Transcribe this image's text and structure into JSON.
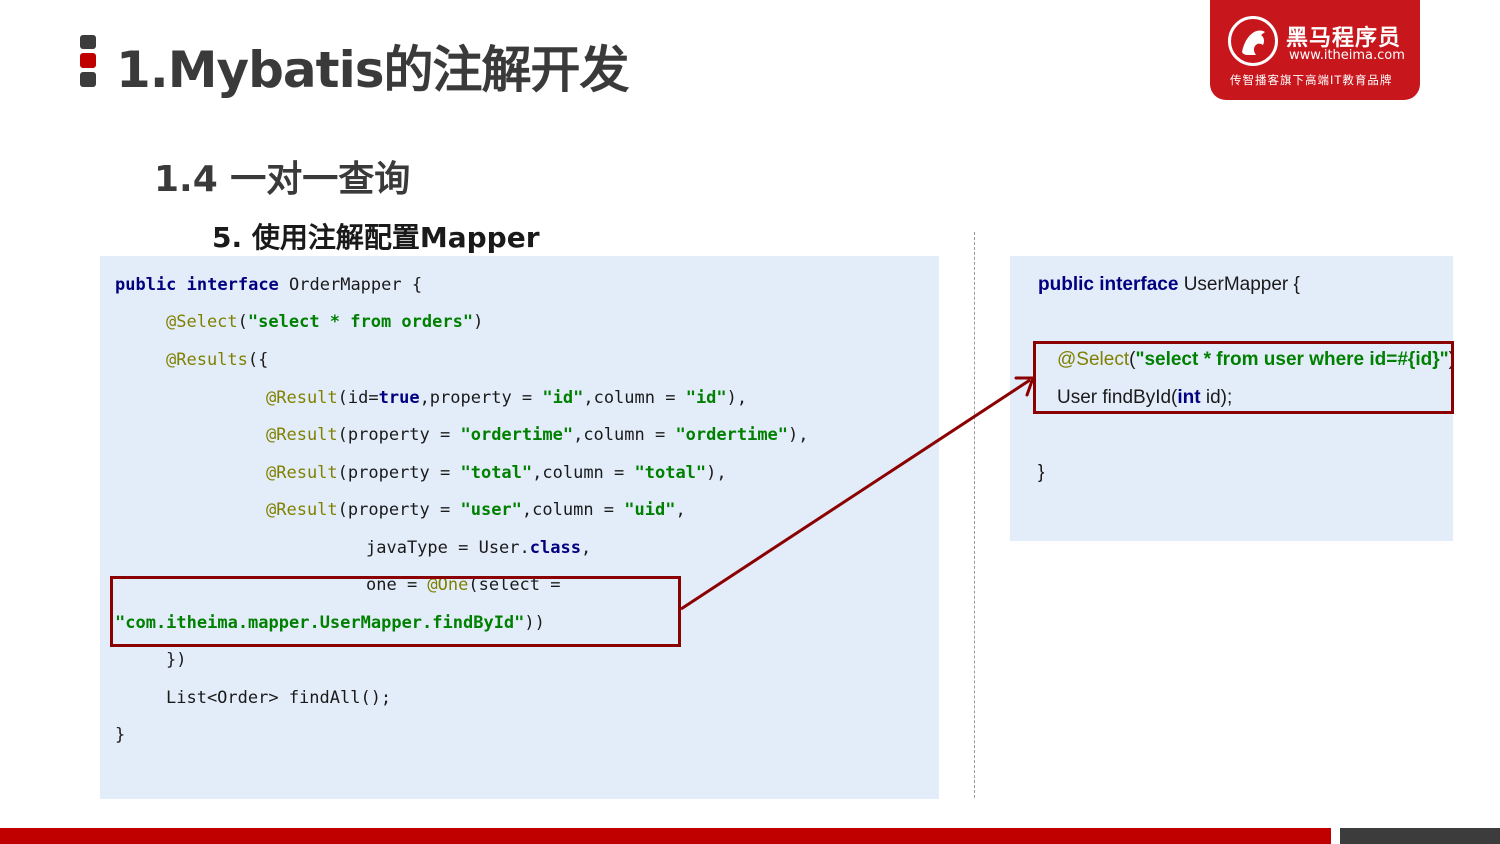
{
  "slide": {
    "title": "1.Mybatis的注解开发",
    "section": "1.4 一对一查询",
    "subsection": "5.  使用注解配置Mapper"
  },
  "logo": {
    "name": "黑马程序员",
    "url": "www.itheima.com",
    "slogan": "传智播客旗下高端IT教育品牌"
  },
  "left_code": {
    "l1": {
      "kw1": "public",
      "kw2": "interface",
      "rest": " OrderMapper {"
    },
    "l2": {
      "ann": "@Select",
      "p1": "(",
      "str": "\"select * from orders\"",
      "p2": ")"
    },
    "l3": {
      "ann": "@Results",
      "p1": "({"
    },
    "l4": {
      "ann": "@Result",
      "p1": "(id=",
      "kw": "true",
      "p2": ",property = ",
      "s1": "\"id\"",
      "p3": ",column = ",
      "s2": "\"id\"",
      "p4": "),"
    },
    "l5": {
      "ann": "@Result",
      "p1": "(property = ",
      "s1": "\"ordertime\"",
      "p2": ",column = ",
      "s2": "\"ordertime\"",
      "p3": "),"
    },
    "l6": {
      "ann": "@Result",
      "p1": "(property = ",
      "s1": "\"total\"",
      "p2": ",column = ",
      "s2": "\"total\"",
      "p3": "),"
    },
    "l7": {
      "ann": "@Result",
      "p1": "(property = ",
      "s1": "\"user\"",
      "p2": ",column = ",
      "s2": "\"uid\"",
      "p3": ","
    },
    "l8": {
      "p1": "javaType = User.",
      "kw": "class",
      "p2": ","
    },
    "l9": {
      "p1": "one = ",
      "ann": "@One",
      "p2": "(select ="
    },
    "l10": {
      "str": "\"com.itheima.mapper.UserMapper.findById\"",
      "p1": "))"
    },
    "l11": "})",
    "l12": "List<Order> findAll();",
    "l13": "}"
  },
  "right_code": {
    "l1": {
      "kw": "public interface",
      "rest": " UserMapper {"
    },
    "l2": {
      "ann": "@Select",
      "p1": "(",
      "str": "\"select * from user where id=#{id}\"",
      "p2": ")"
    },
    "l3": {
      "p1": "User findById(",
      "kw": "int",
      "p2": " id);"
    },
    "l4": "}"
  },
  "colors": {
    "accent_red": "#c00000",
    "logo_red": "#c8161d",
    "highlight_box": "#8b0000",
    "code_bg": "#e3edfa",
    "keyword": "#000080",
    "string": "#008000",
    "annotation": "#808000"
  }
}
